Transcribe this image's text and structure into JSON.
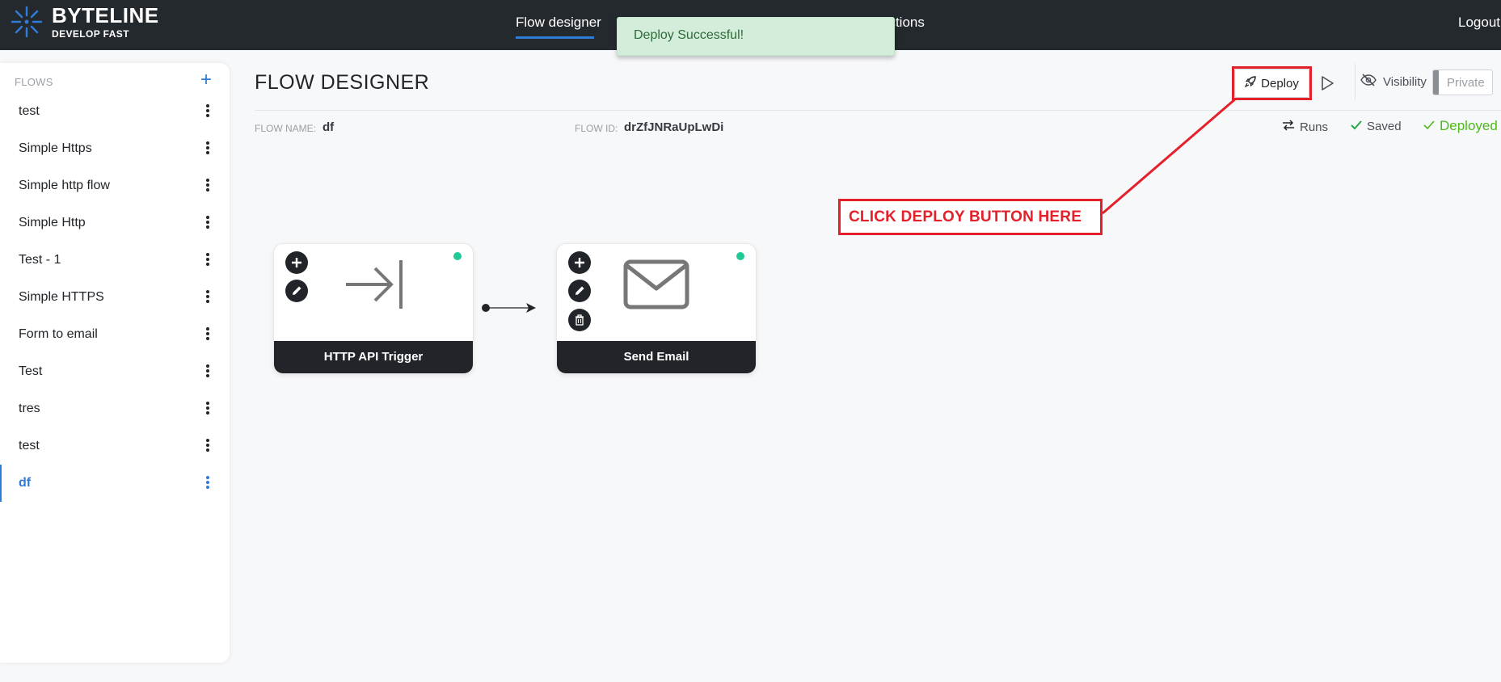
{
  "brand": {
    "name": "BYTELINE",
    "tagline": "DEVELOP FAST"
  },
  "nav": {
    "active": "Flow designer",
    "partial": "ections",
    "logout": "Logout"
  },
  "toast": {
    "message": "Deploy Successful!"
  },
  "sidebar": {
    "header": "FLOWS",
    "add_symbol": "+",
    "items": [
      {
        "label": "test"
      },
      {
        "label": "Simple Https"
      },
      {
        "label": "Simple http flow"
      },
      {
        "label": "Simple Http"
      },
      {
        "label": "Test - 1"
      },
      {
        "label": "Simple HTTPS"
      },
      {
        "label": "Form to email"
      },
      {
        "label": "Test"
      },
      {
        "label": "tres"
      },
      {
        "label": "test"
      },
      {
        "label": "df",
        "active": true
      }
    ]
  },
  "header": {
    "title": "FLOW DESIGNER",
    "deploy_label": "Deploy",
    "visibility_label": "Visibility",
    "visibility_value": "Private"
  },
  "meta": {
    "flow_name_key": "FLOW NAME:",
    "flow_name": "df",
    "flow_id_key": "FLOW ID:",
    "flow_id": "drZfJNRaUpLwDi",
    "runs": "Runs",
    "saved": "Saved",
    "deployed": "Deployed"
  },
  "annotation": {
    "text": "CLICK DEPLOY BUTTON HERE"
  },
  "nodes": [
    {
      "label": "HTTP API Trigger",
      "icon": "arrow-to-line-icon"
    },
    {
      "label": "Send Email",
      "icon": "envelope-icon"
    }
  ],
  "colors": {
    "topbar": "#24292e",
    "accent": "#2f7bd8",
    "success": "#4cbb17",
    "annotation": "#e4202b",
    "node_status": "#20c997"
  }
}
